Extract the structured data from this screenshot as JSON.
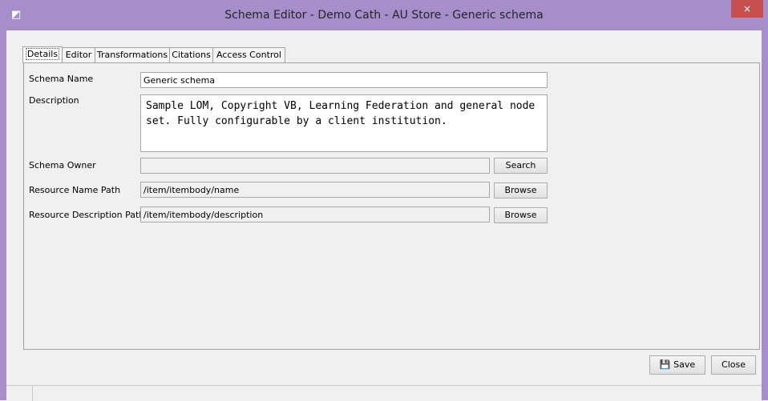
{
  "window": {
    "title": "Schema Editor - Demo Cath - AU Store - Generic schema",
    "close_glyph": "×",
    "app_icon_glyph": "◩"
  },
  "tabs": [
    {
      "label": "Details",
      "active": true
    },
    {
      "label": "Editor",
      "active": false
    },
    {
      "label": "Transformations",
      "active": false
    },
    {
      "label": "Citations",
      "active": false
    },
    {
      "label": "Access Control",
      "active": false
    }
  ],
  "form": {
    "schema_name_label": "Schema Name",
    "schema_name_value": "Generic schema",
    "description_label": "Description",
    "description_value": "Sample LOM, Copyright VB, Learning Federation and general node set. Fully configurable by a client institution.",
    "schema_owner_label": "Schema Owner",
    "schema_owner_value": "",
    "search_button": "Search",
    "resource_name_path_label": "Resource Name Path",
    "resource_name_path_value": "/item/itembody/name",
    "browse_button": "Browse",
    "resource_description_path_label": "Resource Description Path",
    "resource_description_path_value": "/item/itembody/description"
  },
  "footer": {
    "save_label": "Save",
    "close_label": "Close",
    "save_icon": "💾"
  }
}
